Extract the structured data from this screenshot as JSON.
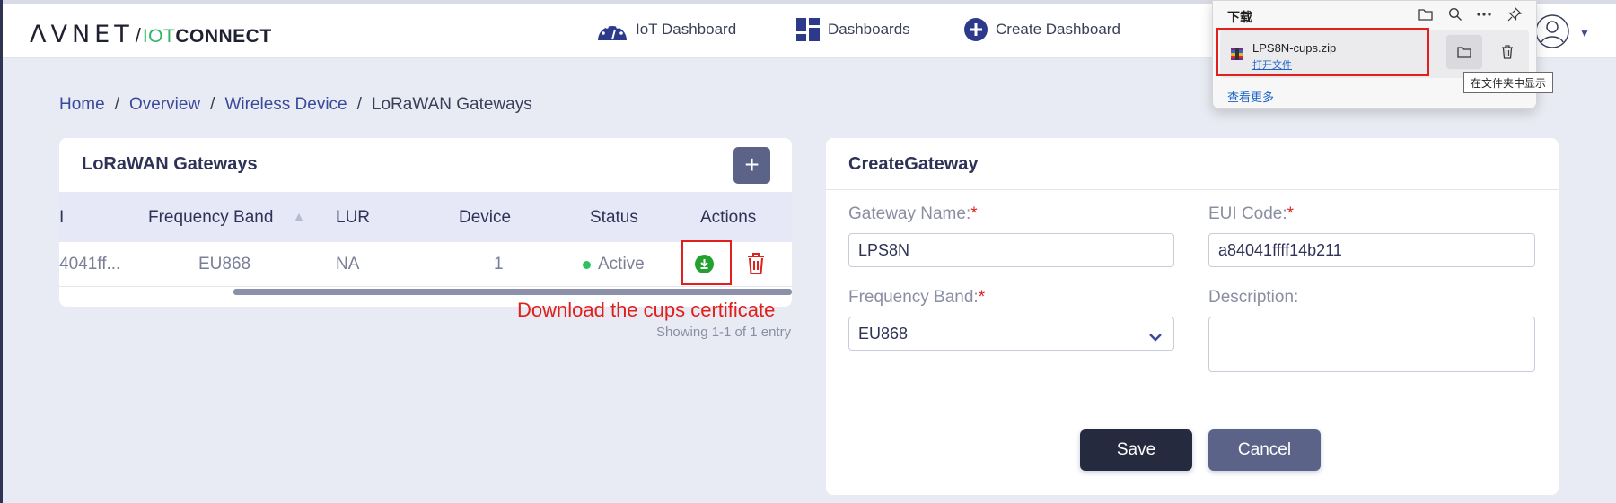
{
  "header": {
    "logo": {
      "avnet": "ΛVNET",
      "iot": "IOT",
      "connect": "CONNECT"
    },
    "nav": [
      {
        "label": "IoT Dashboard",
        "icon": "gauge-icon"
      },
      {
        "label": "Dashboards",
        "icon": "dashboard-grid-icon"
      },
      {
        "label": "Create Dashboard",
        "icon": "plus-circle-icon"
      }
    ]
  },
  "breadcrumb": {
    "items": [
      "Home",
      "Overview",
      "Wireless Device"
    ],
    "current": "LoRaWAN Gateways",
    "separator": "/"
  },
  "gateways": {
    "title": "LoRaWAN Gateways",
    "add_label": "+",
    "columns": [
      "I",
      "Frequency Band",
      "LUR",
      "Device",
      "Status",
      "Actions"
    ],
    "row": {
      "id": "4041ff...",
      "frequency_band": "EU868",
      "lur": "NA",
      "device": "1",
      "status": "Active"
    },
    "annotation": "Download the cups certificate",
    "showing": "Showing 1-1 of 1 entry"
  },
  "create_gateway": {
    "title": "CreateGateway",
    "gateway_name_label": "Gateway Name:",
    "gateway_name_value": "LPS8N",
    "eui_label": "EUI Code:",
    "eui_value": "a84041ffff14b211",
    "frequency_label": "Frequency Band:",
    "frequency_value": "EU868",
    "description_label": "Description:",
    "required_mark": "*",
    "save_label": "Save",
    "cancel_label": "Cancel"
  },
  "download_popup": {
    "title": "下载",
    "file_name": "LPS8N-cups.zip",
    "open_file": "打开文件",
    "see_more": "查看更多",
    "tooltip": "在文件夹中显示"
  },
  "colors": {
    "accent": "#3a4a9a",
    "brand_green": "#2fb566",
    "status_active": "#2fc15e",
    "danger": "#e0201c",
    "save_button": "#252a3f",
    "cancel_button": "#5b6488"
  }
}
